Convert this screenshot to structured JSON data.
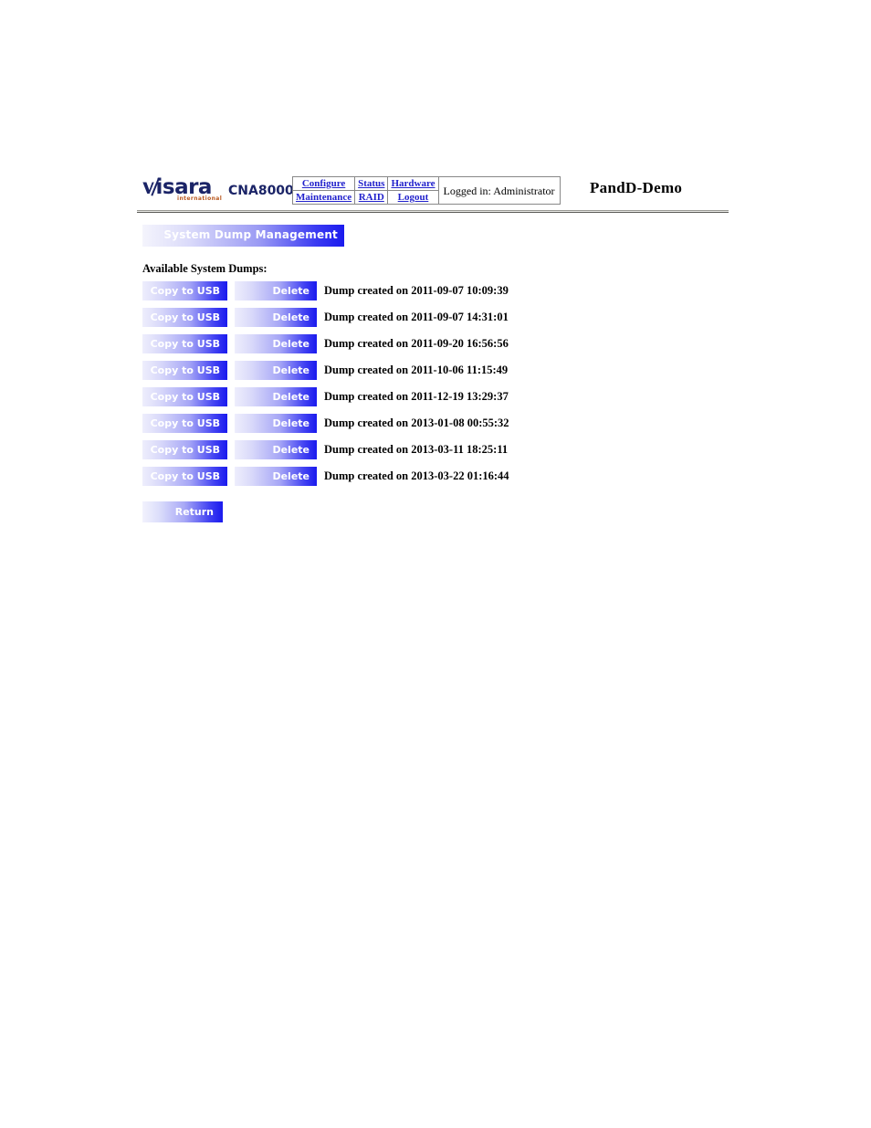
{
  "header": {
    "logo": {
      "word": "visara",
      "sub": "international",
      "icon": "visara-logo"
    },
    "product_name": "CNA8000",
    "site_title": "PandD-Demo",
    "nav": {
      "row1": [
        {
          "label": "Configure"
        },
        {
          "label": "Status"
        },
        {
          "label": "Hardware"
        }
      ],
      "row2": [
        {
          "label": "Maintenance"
        },
        {
          "label": "RAID"
        },
        {
          "label": "Logout"
        }
      ],
      "logged_in": "Logged in: Administrator"
    }
  },
  "page": {
    "banner_title": "System Dump Management",
    "section_label": "Available System Dumps:",
    "copy_label": "Copy to USB",
    "delete_label": "Delete",
    "return_label": "Return",
    "dumps": [
      {
        "text": "Dump created on 2011-09-07 10:09:39"
      },
      {
        "text": "Dump created on 2011-09-07 14:31:01"
      },
      {
        "text": "Dump created on 2011-09-20 16:56:56"
      },
      {
        "text": "Dump created on 2011-10-06 11:15:49"
      },
      {
        "text": "Dump created on 2011-12-19 13:29:37"
      },
      {
        "text": "Dump created on 2013-01-08 00:55:32"
      },
      {
        "text": "Dump created on 2013-03-11 18:25:11"
      },
      {
        "text": "Dump created on 2013-03-22 01:16:44"
      }
    ]
  },
  "colors": {
    "brand_navy": "#1b2467",
    "brand_orange": "#b9581f",
    "link_blue": "#2222cc",
    "gradient_end": "#1a1aee"
  }
}
